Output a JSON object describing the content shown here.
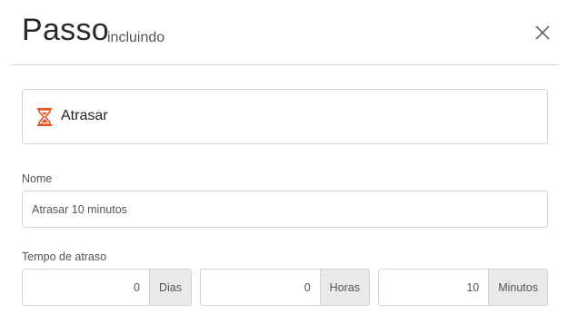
{
  "header": {
    "title": "Passo",
    "subtitle": "incluindo",
    "close_icon": "close-icon"
  },
  "step": {
    "icon": "hourglass-icon",
    "icon_color": "#e8531f",
    "label": "Atrasar"
  },
  "form": {
    "nome_label": "Nome",
    "nome_value": "Atrasar 10 minutos",
    "tempo_label": "Tempo de atraso",
    "dias_value": "0",
    "dias_unit": "Dias",
    "horas_value": "0",
    "horas_unit": "Horas",
    "minutos_value": "10",
    "minutos_unit": "Minutos"
  }
}
